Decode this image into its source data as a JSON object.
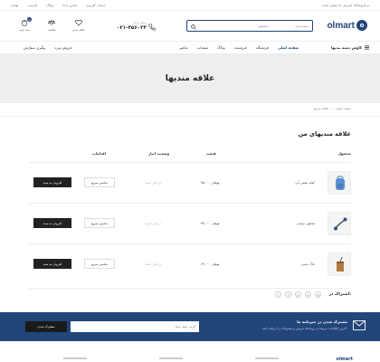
{
  "topbar": {
    "notice": "به فروشگاه اینترنتی ما خوش آمدید",
    "links": [
      "تومان",
      "فارسی",
      "وبلاگ",
      "تماس با ما",
      "حساب کاربری"
    ]
  },
  "header": {
    "logo_mark": "o",
    "logo_text": "olmart",
    "search_category": "دسته بندی",
    "search_placeholder": "جستجو...",
    "phone_label": "تماس با ما",
    "phone_number": "۰۲۱-۴۵۶۰۳۳",
    "icons": [
      {
        "name": "cart",
        "label": "سبد خرید",
        "badge": "0"
      },
      {
        "name": "compare",
        "label": "مقایسه",
        "badge": ""
      },
      {
        "name": "wishlist",
        "label": "علاقه مندی",
        "badge": ""
      }
    ]
  },
  "nav": {
    "categories_label": "کاوش دسته بندیها",
    "menu": [
      "صفحه اصلی",
      "فروشگاه",
      "فروشنده",
      "وبلاگ",
      "صفحات",
      "عناصر"
    ],
    "extras": [
      "پیگیری سفارش",
      "فروش ویژه"
    ]
  },
  "banner": {
    "title": "علاقه مندیها"
  },
  "breadcrumb": {
    "home": "صفحه اصلی",
    "current": "علاقه مندیها"
  },
  "wishlist": {
    "title": "علاقه مندیهای من",
    "columns": {
      "product": "محصول",
      "price": "قیمت",
      "stock": "وضعیت انبار",
      "actions": "اقدامات"
    },
    "items": [
      {
        "name": "کوله پشتی آبی",
        "price": "۴۵,۰۰۰ تومان",
        "stock": "در انبار است",
        "quick_view": "نمایش سریع",
        "add_to_cart": "افزودن به سبد"
      },
      {
        "name": "هدفون سیمی",
        "price": "۳۷,۰۰۰ تومان",
        "stock": "در انبار است",
        "quick_view": "نمایش سریع",
        "add_to_cart": "افزودن به سبد"
      },
      {
        "name": "ماگ مسی",
        "price": "۶۳,۰۰۰ تومان",
        "stock": "در انبار است",
        "quick_view": "نمایش سریع",
        "add_to_cart": "افزودن به سبد"
      }
    ],
    "share_label": "اشتراک در:",
    "socials": [
      "f",
      "t",
      "p",
      "in",
      "@"
    ]
  },
  "newsletter": {
    "title": "مشترک شدن در خبرنامه ما",
    "subtitle": "آخرین اطلاعات مربوط به رویدادها، فروش و پیشنهادات را دریافت کنید.",
    "placeholder": "آدرس ایمیل شما",
    "button": "مشترک شدن"
  },
  "footer": {
    "logo": "olmart"
  },
  "colors": {
    "brand": "#22457a",
    "dark_button": "#222222",
    "banner_bg": "#eeeeee"
  }
}
